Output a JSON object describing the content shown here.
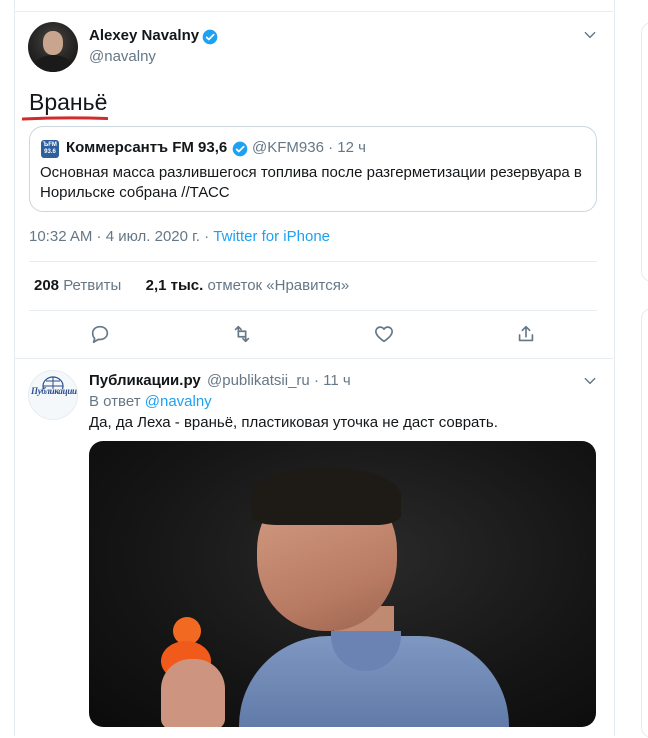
{
  "tweet": {
    "author": {
      "name": "Alexey Navalny",
      "handle": "@navalny"
    },
    "text": "Враньё",
    "quoted": {
      "logo_text": "ЪFM 93.6",
      "name": "Коммерсантъ FM 93,6",
      "handle": "@KFM936",
      "age": "12 ч",
      "text": "Основная масса разлившегося топлива после разгерметизации резервуара в Норильске собрана //ТАСС"
    },
    "timestamp": "10:32 AM · 4 июл. 2020 г.",
    "separator": " · ",
    "source": "Twitter for iPhone",
    "stats": {
      "retweets_count": "208",
      "retweets_label": "Ретвиты",
      "likes_count": "2,1 тыс.",
      "likes_label": "отметок «Нравится»"
    },
    "actions": [
      "reply-icon",
      "retweet-icon",
      "like-icon",
      "share-icon"
    ]
  },
  "reply": {
    "avatar_text": "Публикации.Ру",
    "author": {
      "name": "Публикации.ру",
      "handle": "@publikatsii_ru",
      "age": "11 ч"
    },
    "in_reply_label": "В ответ",
    "in_reply_to": "@navalny",
    "text": "Да, да Леха - враньё, пластиковая уточка не даст соврать."
  },
  "colors": {
    "link": "#1da1f2",
    "secondary_text": "#657786",
    "annotation_underline": "#d12b2b",
    "verified": "#1da1f2"
  }
}
